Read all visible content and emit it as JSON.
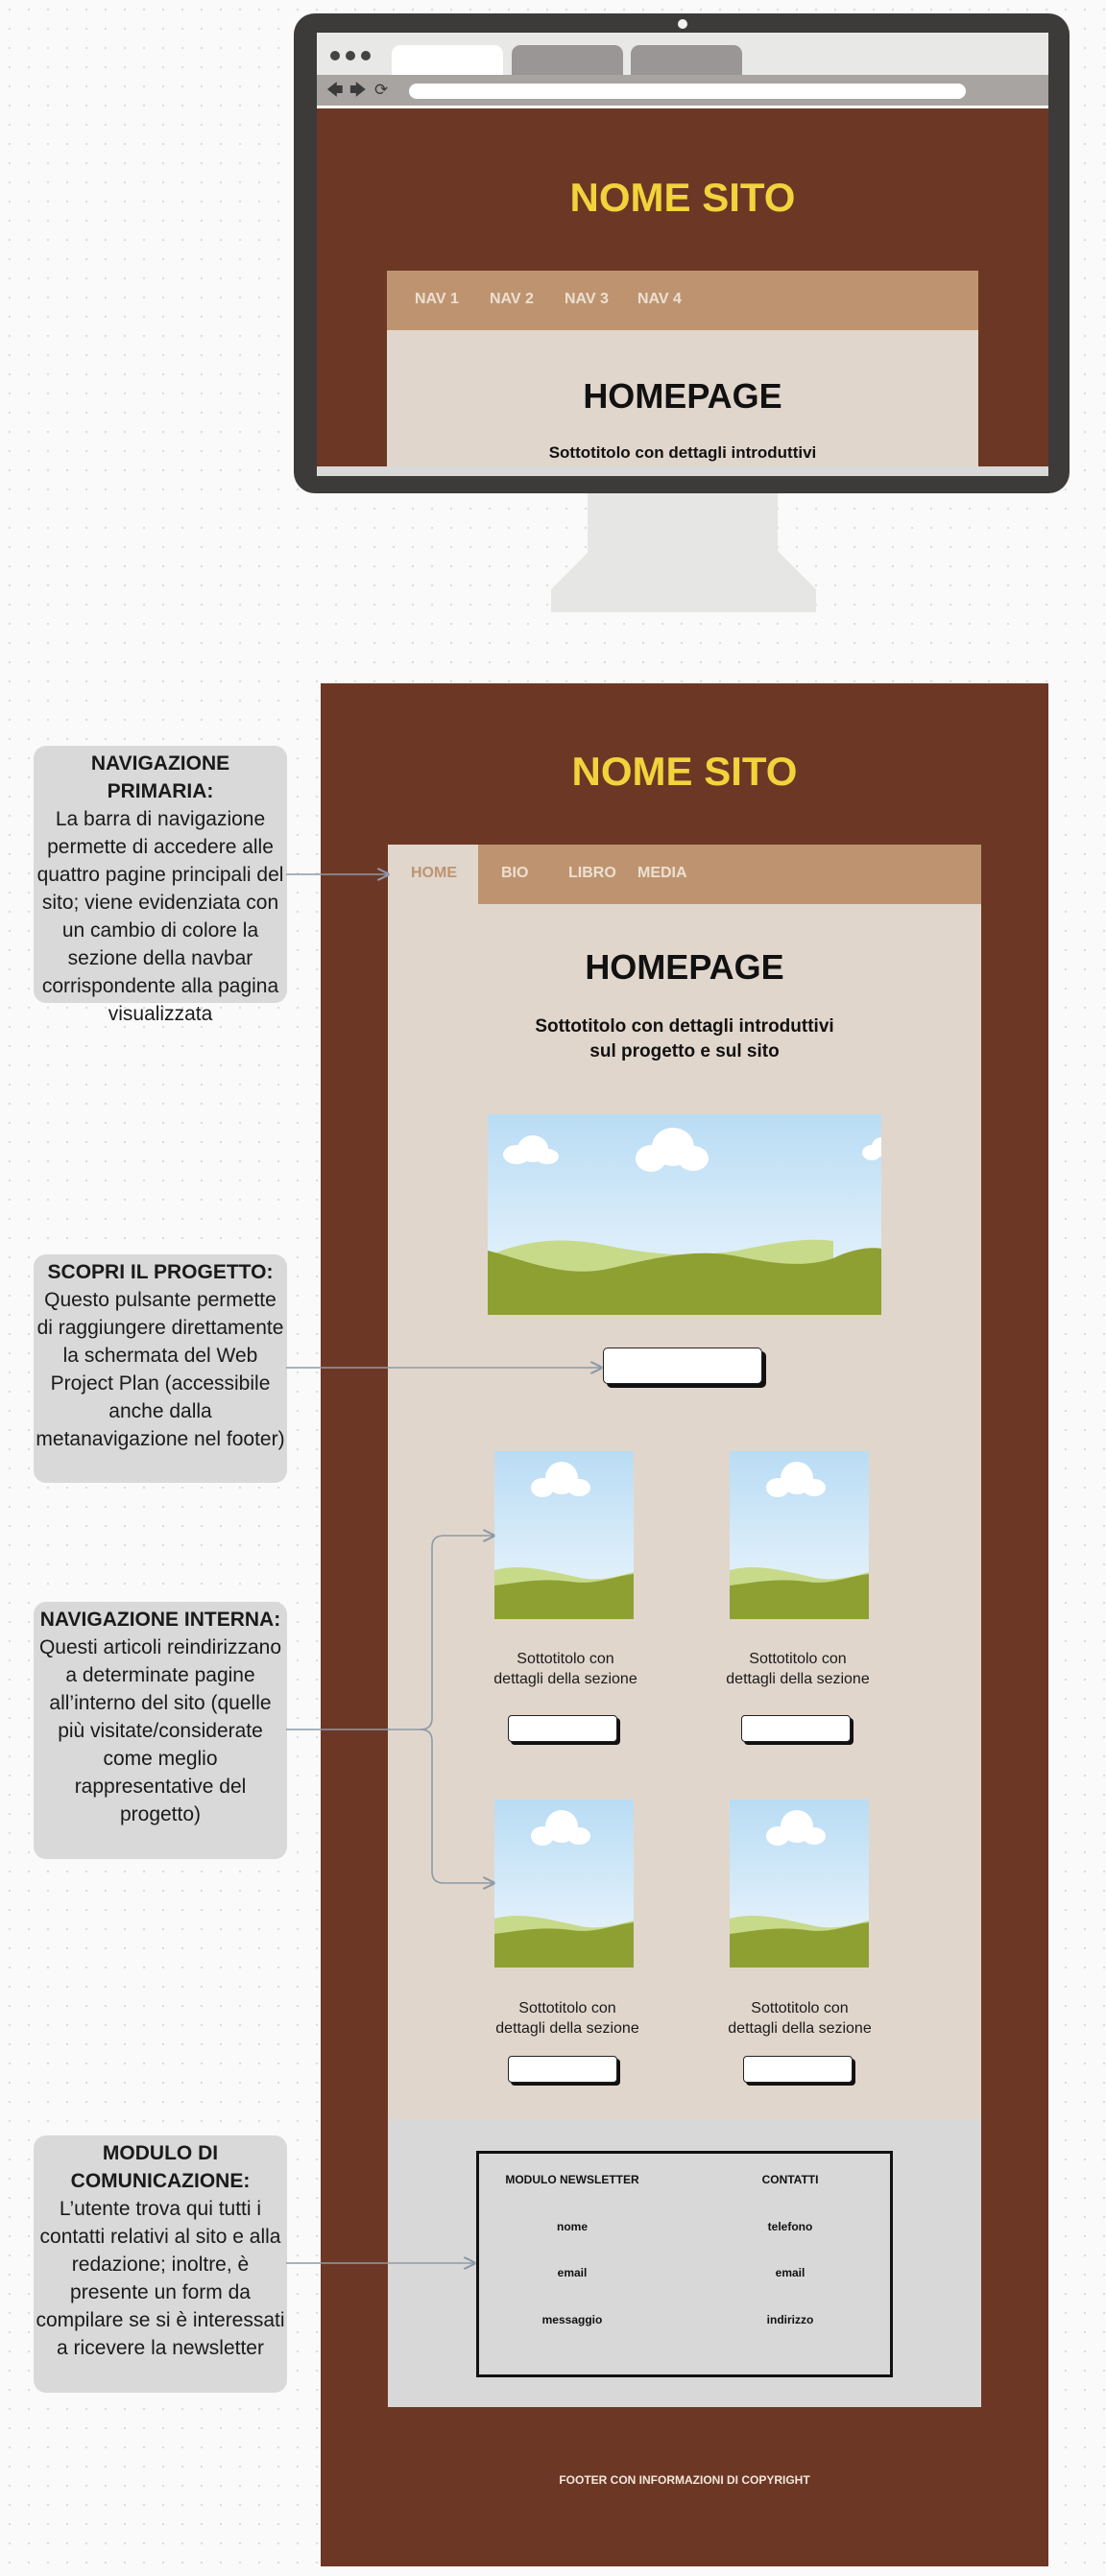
{
  "colors": {
    "page_background": "#fafafa",
    "site_brown": "#6c3825",
    "title_yellow": "#f2d33c",
    "nav_tan": "#be9470",
    "content_beige": "#e1d6cc",
    "comm_gray": "#d8d8d8",
    "note_gray": "#d9d9d9",
    "monitor_frame": "#3d3a3a",
    "sky": "#d6ecfb",
    "hill_dark": "#8fa033",
    "hill_light": "#c6da8a"
  },
  "monitor_preview": {
    "browser_controls": [
      "back-arrow-icon",
      "forward-arrow-icon",
      "reload-icon"
    ],
    "site_title": "NOME SITO",
    "nav_items": [
      "NAV 1",
      "NAV 2",
      "NAV 3",
      "NAV 4"
    ],
    "heading": "HOMEPAGE",
    "subtitle": "Sottotitolo con dettagli introduttivi"
  },
  "page": {
    "site_title": "NOME SITO",
    "nav_items": [
      "HOME",
      "BIO",
      "LIBRO",
      "MEDIA"
    ],
    "heading": "HOMEPAGE",
    "subtitle_line1": "Sottotitolo con dettagli introduttivi",
    "subtitle_line2": "sul progetto e sul sito",
    "hero_image_icon": "landscape-image-icon",
    "cards": [
      {
        "line1": "Sottotitolo con",
        "line2": "dettagli della sezione"
      },
      {
        "line1": "Sottotitolo con",
        "line2": "dettagli della sezione"
      },
      {
        "line1": "Sottotitolo con",
        "line2": "dettagli della sezione"
      },
      {
        "line1": "Sottotitolo con",
        "line2": "dettagli della sezione"
      }
    ],
    "form": {
      "newsletter_title": "MODULO NEWSLETTER",
      "contacts_title": "CONTATTI",
      "newsletter_fields": [
        "nome",
        "email",
        "messaggio"
      ],
      "contact_fields": [
        "telefono",
        "email",
        "indirizzo"
      ]
    },
    "footer": "FOOTER CON INFORMAZIONI DI COPYRIGHT"
  },
  "annotations": [
    {
      "title": "NAVIGAZIONE PRIMARIA:",
      "body": "La barra di navigazione permette di accedere alle quattro pagine principali del sito; viene evidenziata con un cambio di colore la sezione della navbar corrispondente alla pagina visualizzata"
    },
    {
      "title": "SCOPRI IL PROGETTO:",
      "body": "Questo pulsante permette di raggiungere direttamente la schermata del Web Project Plan (accessibile anche dalla metanavigazione nel footer)"
    },
    {
      "title": "NAVIGAZIONE INTERNA:",
      "body": "Questi articoli reindirizzano a determinate pagine all’interno del sito (quelle più visitate/considerate come meglio rappresentative del progetto)"
    },
    {
      "title": "MODULO DI COMUNICAZIONE:",
      "body": "L’utente trova qui tutti i contatti relativi al sito e alla redazione; inoltre, è presente un form da compilare se si è interessati a ricevere la newsletter"
    }
  ]
}
